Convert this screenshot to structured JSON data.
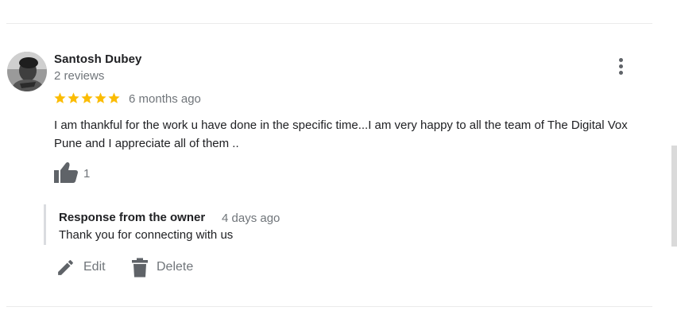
{
  "review": {
    "reviewer_name": "Santosh Dubey",
    "reviewer_reviews": "2 reviews",
    "rating": 5,
    "date": "6 months ago",
    "text": "I am thankful for the work u have done in the specific time...I am very happy to all the team of The Digital Vox Pune and I appreciate all of them ..",
    "likes": "1"
  },
  "owner_response": {
    "title": "Response from the owner",
    "date": "4 days ago",
    "text": "Thank you for connecting with us"
  },
  "actions": {
    "edit_label": "Edit",
    "delete_label": "Delete"
  },
  "colors": {
    "star": "#fbbc04",
    "icon": "#5f6368",
    "secondary_text": "#70757a"
  },
  "icons": [
    "more-vert-icon",
    "star-icon",
    "thumb-up-icon",
    "pencil-icon",
    "trash-icon"
  ]
}
